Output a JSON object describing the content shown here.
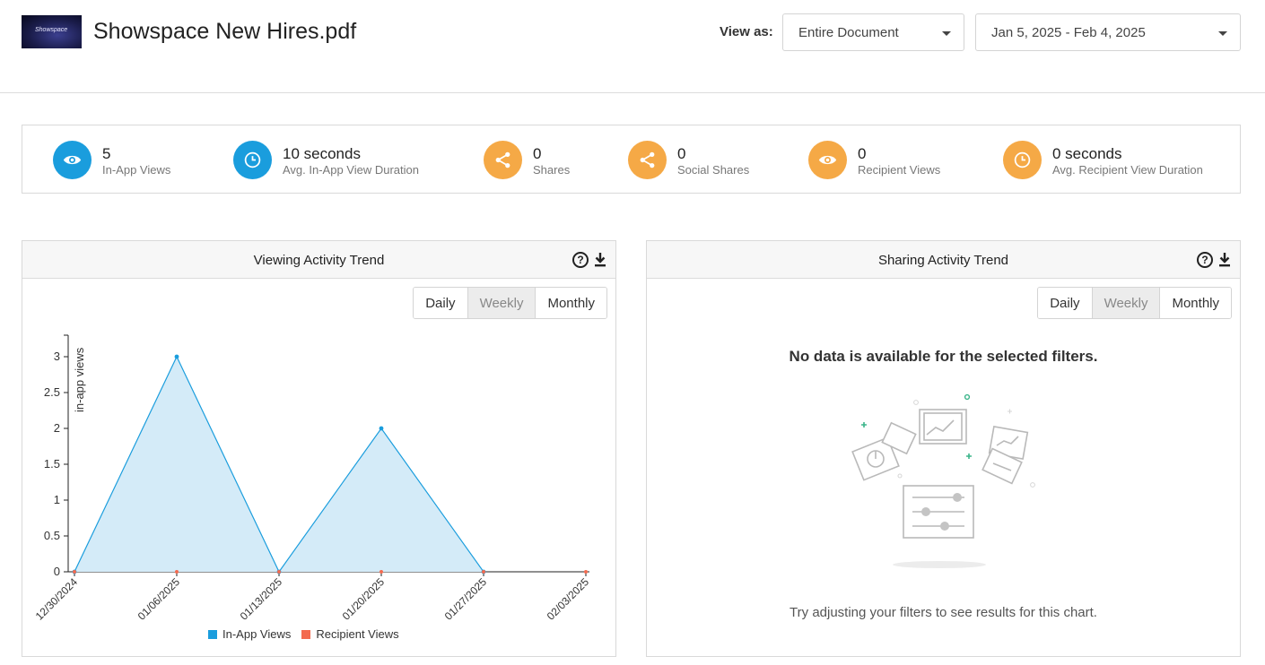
{
  "header": {
    "thumbnail_text": "Showspace",
    "doc_title": "Showspace New Hires.pdf",
    "view_as_label": "View as:",
    "view_select": "Entire Document",
    "date_select": "Jan 5, 2025 - Feb 4, 2025"
  },
  "stats": [
    {
      "value": "5",
      "label": "In-App Views",
      "icon": "eye-icon",
      "color": "#1a9ddd"
    },
    {
      "value": "10 seconds",
      "label": "Avg. In-App View Duration",
      "icon": "clock-icon",
      "color": "#1a9ddd"
    },
    {
      "value": "0",
      "label": "Shares",
      "icon": "share-icon",
      "color": "#f5a946"
    },
    {
      "value": "0",
      "label": "Social Shares",
      "icon": "share-icon",
      "color": "#f5a946"
    },
    {
      "value": "0",
      "label": "Recipient Views",
      "icon": "eye-icon",
      "color": "#f5a946"
    },
    {
      "value": "0 seconds",
      "label": "Avg. Recipient View Duration",
      "icon": "clock-icon",
      "color": "#f5a946"
    }
  ],
  "viewing_panel": {
    "title": "Viewing Activity Trend",
    "tabs": [
      "Daily",
      "Weekly",
      "Monthly"
    ],
    "active_tab": "Weekly"
  },
  "sharing_panel": {
    "title": "Sharing Activity Trend",
    "tabs": [
      "Daily",
      "Weekly",
      "Monthly"
    ],
    "active_tab": "Weekly",
    "empty_title": "No data is available for the selected filters.",
    "empty_subtitle": "Try adjusting your filters to see results for this chart."
  },
  "chart_data": {
    "type": "area",
    "title": "",
    "ylabel": "in-app views",
    "xlabel": "",
    "x": [
      "12/30/2024",
      "01/06/2025",
      "01/13/2025",
      "01/20/2025",
      "01/27/2025",
      "02/03/2025"
    ],
    "yticks": [
      "0",
      "0.5",
      "1",
      "1.5",
      "2",
      "2.5",
      "3"
    ],
    "ylim": [
      0,
      3.3
    ],
    "series": [
      {
        "name": "In-App Views",
        "values": [
          0,
          3,
          0,
          2,
          0,
          null
        ],
        "color": "#1a9ddd"
      },
      {
        "name": "Recipient Views",
        "values": [
          0,
          0,
          0,
          0,
          0,
          0
        ],
        "color": "#f36b50"
      }
    ],
    "legend": "bottom"
  }
}
